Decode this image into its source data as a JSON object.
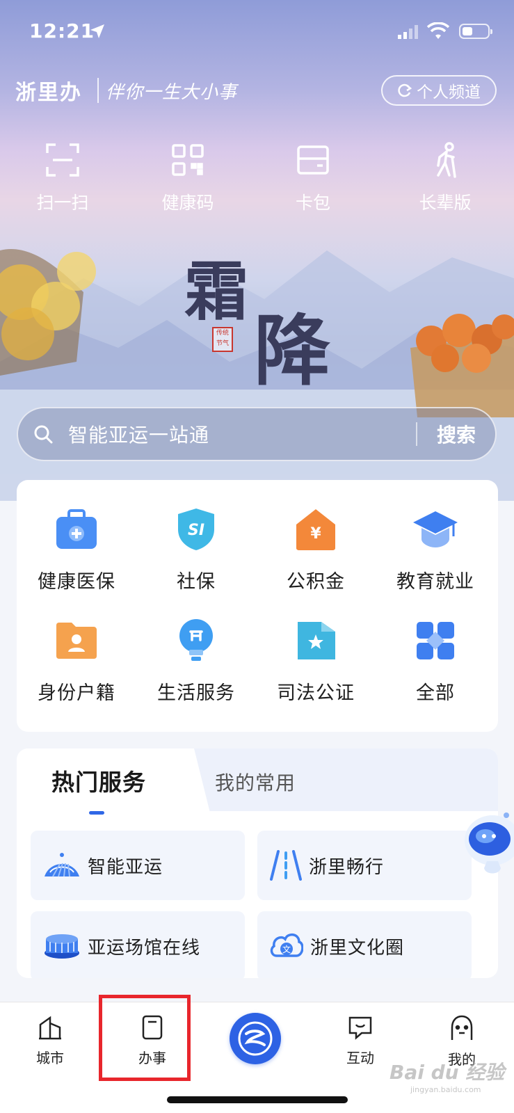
{
  "status_bar": {
    "time": "12:21"
  },
  "header": {
    "app_name": "浙里办",
    "slogan": "伴你一生大小事",
    "personal_channel": "个人频道"
  },
  "quick_actions": [
    {
      "label": "扫一扫",
      "icon": "scan-icon"
    },
    {
      "label": "健康码",
      "icon": "qrcode-icon"
    },
    {
      "label": "卡包",
      "icon": "card-wallet-icon"
    },
    {
      "label": "长辈版",
      "icon": "elder-icon"
    }
  ],
  "banner": {
    "title_1": "霜",
    "title_2": "降",
    "seal_1": "传统",
    "seal_2": "节气"
  },
  "search": {
    "placeholder": "智能亚运一站通",
    "button": "搜索"
  },
  "services": [
    {
      "label": "健康医保",
      "icon": "medical-kit-icon"
    },
    {
      "label": "社保",
      "icon": "social-security-shield-icon"
    },
    {
      "label": "公积金",
      "icon": "housing-fund-icon"
    },
    {
      "label": "教育就业",
      "icon": "graduation-cap-icon"
    },
    {
      "label": "身份户籍",
      "icon": "id-folder-icon"
    },
    {
      "label": "生活服务",
      "icon": "lightbulb-icon"
    },
    {
      "label": "司法公证",
      "icon": "justice-icon"
    },
    {
      "label": "全部",
      "icon": "grid-all-icon"
    }
  ],
  "hot_services": {
    "tabs": [
      "热门服务",
      "我的常用"
    ],
    "items": [
      {
        "label": "智能亚运",
        "icon": "asian-games-icon"
      },
      {
        "label": "浙里畅行",
        "icon": "road-icon"
      },
      {
        "label": "亚运场馆在线",
        "icon": "stadium-icon"
      },
      {
        "label": "浙里文化圈",
        "icon": "culture-icon"
      }
    ]
  },
  "bottom_nav": [
    {
      "label": "城市",
      "icon": "city-icon"
    },
    {
      "label": "办事",
      "icon": "document-icon"
    },
    {
      "label": "",
      "icon": "zheliban-logo-icon"
    },
    {
      "label": "互动",
      "icon": "chat-icon"
    },
    {
      "label": "我的",
      "icon": "profile-icon"
    }
  ],
  "watermark": {
    "text": "Bai du 经验",
    "sub": "jingyan.baidu.com"
  },
  "colors": {
    "accent": "#2d62e4",
    "highlight": "#e8262c"
  }
}
